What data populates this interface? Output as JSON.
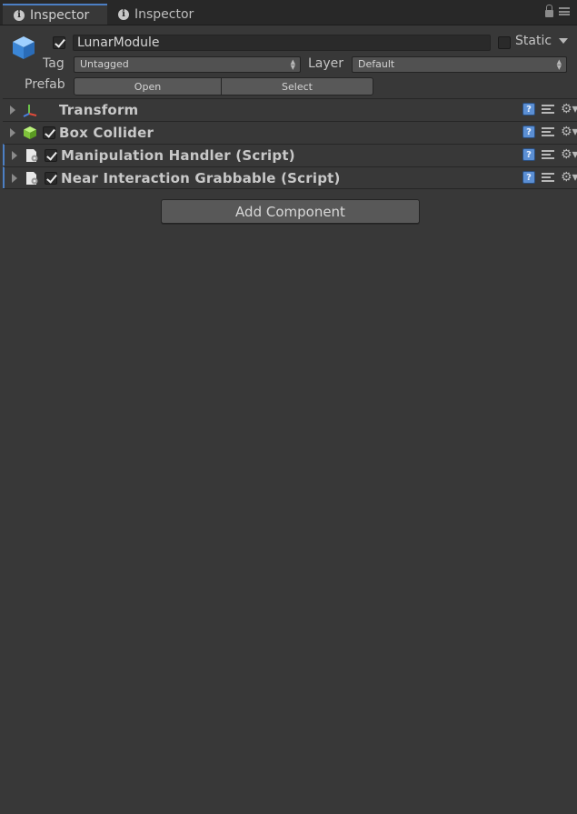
{
  "tabs": [
    {
      "label": "Inspector",
      "active": true
    },
    {
      "label": "Inspector",
      "active": false
    }
  ],
  "header": {
    "active_checked": true,
    "name": "LunarModule",
    "static_label": "Static",
    "static_checked": false,
    "tag_label": "Tag",
    "tag_value": "Untagged",
    "layer_label": "Layer",
    "layer_value": "Default",
    "prefab_label": "Prefab",
    "prefab_open": "Open",
    "prefab_select": "Select"
  },
  "components": [
    {
      "title": "Transform",
      "icon": "transform-axes-icon",
      "has_checkbox": false
    },
    {
      "title": "Box Collider",
      "icon": "box-collider-icon",
      "has_checkbox": true,
      "checked": true
    },
    {
      "title": "Manipulation Handler (Script)",
      "icon": "script-icon",
      "has_checkbox": true,
      "checked": true
    },
    {
      "title": "Near Interaction Grabbable (Script)",
      "icon": "script-icon",
      "has_checkbox": true,
      "checked": true
    }
  ],
  "help_glyph": "?",
  "add_component_label": "Add Component",
  "colors": {
    "accent": "#4c7fc4",
    "background": "#383838",
    "help": "#5b8fd4"
  }
}
